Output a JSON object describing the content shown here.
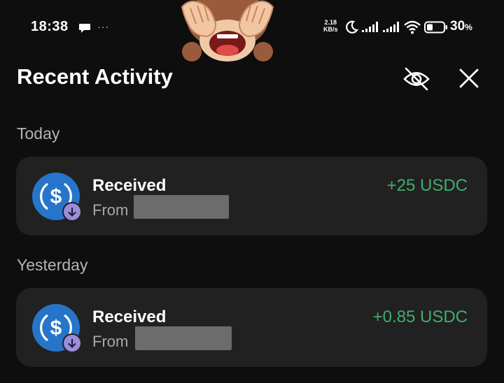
{
  "status_bar": {
    "time": "18:38",
    "more": "···",
    "net_speed_value": "2.18",
    "net_speed_unit": "KB/s",
    "battery_percent": "30",
    "battery_unit": "%",
    "icons": [
      "chat-bubble-icon",
      "moon-icon",
      "signal-icon",
      "signal-icon",
      "wifi-icon",
      "battery-icon"
    ]
  },
  "header": {
    "title": "Recent Activity",
    "hide_icon": "eye-slash-icon",
    "close_icon": "close-icon"
  },
  "sections": [
    {
      "label": "Today",
      "transactions": [
        {
          "type": "Received",
          "from_label": "From",
          "amount": "+25 USDC",
          "icon": "usdc-icon",
          "badge_icon": "arrow-down-icon"
        }
      ]
    },
    {
      "label": "Yesterday",
      "transactions": [
        {
          "type": "Received",
          "from_label": "From",
          "amount": "+0.85 USDC",
          "icon": "usdc-icon",
          "badge_icon": "arrow-down-icon"
        }
      ]
    }
  ],
  "colors": {
    "background": "#0e0e0e",
    "card": "#212121",
    "amount_positive": "#3fae6f",
    "usdc_blue": "#2775ca",
    "badge_purple": "#9c8ce0"
  }
}
